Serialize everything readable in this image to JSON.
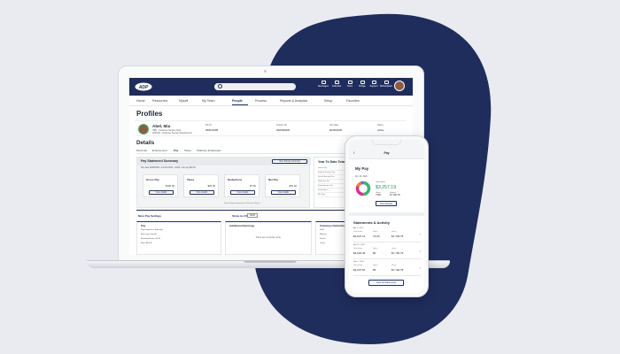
{
  "colors": {
    "background": "#e9ebf0",
    "blob": "#1f2d5c",
    "topbar": "#1f2d5c",
    "accent_green": "#2e8b57"
  },
  "laptop": {
    "logo": "ADP",
    "search": {
      "placeholder": ""
    },
    "top_icons": [
      "Messages",
      "Calendar",
      "Team",
      "Bridge",
      "Support",
      "Marketplace"
    ],
    "nav": [
      "Home",
      "Resources",
      "Myself",
      "My Team",
      "People",
      "Process",
      "Reports & Analytics",
      "Setup",
      "Favorites"
    ],
    "page_title": "Profiles",
    "profile": {
      "name": "Abel, Mia",
      "line1": "HRP - Customer Service Clerk",
      "line2": "AHKXW - Customer Service (Department)",
      "col1_label": "File ID",
      "col1_value": "000012098",
      "col2_label": "Position ID",
      "col2_value": "HDP000000",
      "col3_label": "Hire Date",
      "col3_value": "00/00/0000",
      "col4_label": "Status",
      "col4_value": "Active"
    },
    "details_title": "Details",
    "tabs": [
      "Personal",
      "Employment",
      "Pay",
      "Taxes",
      "Statutory Employees"
    ],
    "pay_summary": {
      "title": "Pay Statement Summary",
      "button": "View full pay summary",
      "meta": "Pay date 00/00/0000  •  Period 00/00 - 00/00  •  Net pay $00.00",
      "cards": [
        {
          "label": "Gross Pay",
          "value": "$100.00",
          "button": "View details"
        },
        {
          "label": "Taxes",
          "value": "$20.00",
          "button": "View details"
        },
        {
          "label": "Deductions",
          "value": "$7.50",
          "button": "View details"
        },
        {
          "label": "Net Pay",
          "value": "$31.46",
          "button": "View details"
        }
      ],
      "footer": "View all pay statements    ◂ Previous    Next ▸"
    },
    "ytd": {
      "title": "Year To Date Totals",
      "rows": [
        "Gross Pay",
        "Federal Income Tax",
        "Social Security Tax",
        "Medicare Tax",
        "State Income Tax",
        "Deductions",
        "Net Pay"
      ]
    },
    "misc_row": {
      "left": "More Pay Settings",
      "mid": "Show As Of",
      "select": "00/00"
    },
    "panels": [
      {
        "title": "Pay",
        "lines": [
          "Pay Frequency: Biweekly",
          "Rate Type: Hourly",
          "Standard Hours: 40.00",
          "Rate: $00.00"
        ]
      },
      {
        "title": "Additional Earnings",
        "message": "There are currently none."
      },
      {
        "title": "Voluntary Deductions",
        "lines": [
          "401K",
          "Medical",
          "Dental",
          "Vision"
        ]
      }
    ]
  },
  "phone": {
    "header_title": "Pay",
    "section_title": "My Pay",
    "date": "Apr 15, 2020",
    "take_home_label": "Take Home",
    "take_home": "$3,257.19",
    "left_label": "Gross",
    "left_value": "7309",
    "right_label": "Deduct.",
    "right_value": "$7,790.75",
    "view_button": "View Details",
    "statements_title": "Statements & Activity",
    "statements": [
      {
        "date": "Apr 1, 2020",
        "take": "$3,037.11",
        "hours": "73.25",
        "gross": "$7,790.75"
      },
      {
        "date": "Mar 15, 2020",
        "take": "$3,032.45",
        "hours": "80",
        "gross": "$7,790.75"
      },
      {
        "date": "Mar 1, 2020",
        "take": "$3,037.87",
        "hours": "80",
        "gross": "$7,790.75"
      }
    ],
    "all_button": "View All Statements",
    "col_labels": {
      "take": "Take Home",
      "hours": "Hours",
      "gross": "Gross"
    }
  }
}
